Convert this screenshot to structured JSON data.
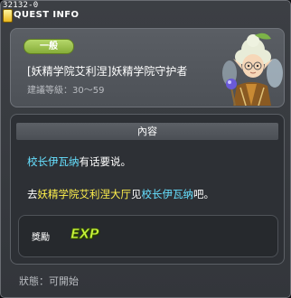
{
  "window": {
    "id_tag": "32132-0",
    "title": "QUEST INFO"
  },
  "header": {
    "badge": "一般",
    "quest_name": "[妖精学院艾利涅]妖精学院守护者",
    "level_text": "建議等級：30～59"
  },
  "content": {
    "section_title": "內容",
    "line1": {
      "npc": "校长伊瓦纳",
      "text": "有话要说。"
    },
    "line2": {
      "prefix": "去",
      "place": "妖精学院艾利涅大厅",
      "mid": "见",
      "npc": "校长伊瓦纳",
      "suffix": "吧。"
    },
    "reward": {
      "label": "獎勵",
      "icon": "exp-icon",
      "icon_text": "EXP"
    }
  },
  "status": "狀態：可開始",
  "colors": {
    "npc_name": "#66e0ff",
    "place_name": "#fff04d",
    "badge": "#9cc44f"
  }
}
